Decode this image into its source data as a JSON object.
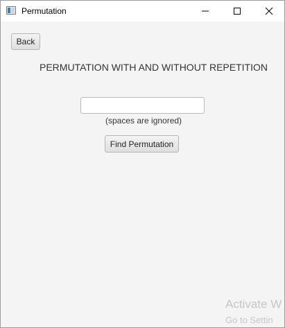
{
  "window": {
    "title": "Permutation",
    "app_icon": "java-app-icon"
  },
  "controls": {
    "minimize_icon": "minimize-icon",
    "maximize_icon": "maximize-icon",
    "close_icon": "close-icon"
  },
  "main": {
    "back_label": "Back",
    "heading": "PERMUTATION WITH AND WITHOUT REPETITION",
    "input": {
      "value": "",
      "placeholder": ""
    },
    "hint": "(spaces are ignored)",
    "find_label": "Find Permutation"
  },
  "watermark": {
    "line1": "Activate W",
    "line2": "Go to Settin"
  },
  "colors": {
    "background": "#f4f4f4",
    "titlebar": "#ffffff",
    "button_border": "#b5b5b5",
    "watermark": "#c6c6c6"
  }
}
